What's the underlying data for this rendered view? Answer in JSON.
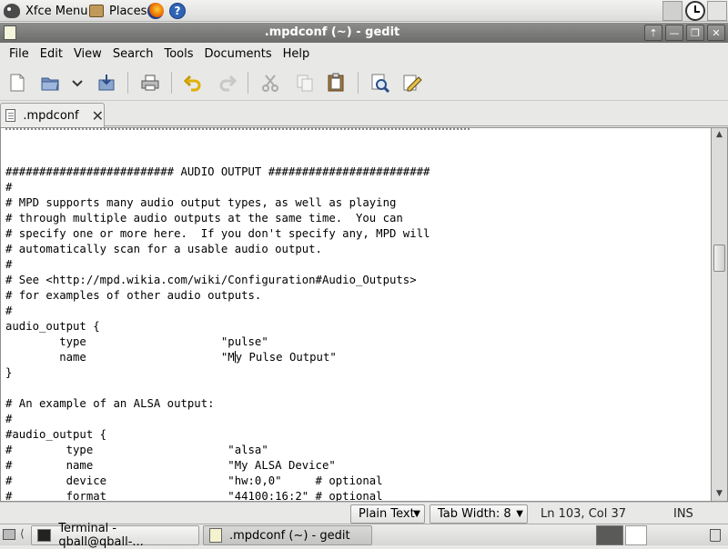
{
  "top_panel": {
    "menu_label": "Xfce Menu",
    "places_label": "Places",
    "help_glyph": "?"
  },
  "window": {
    "title": ".mpdconf (~) - gedit",
    "buttons": [
      "⇡",
      "—",
      "❐",
      "✕"
    ]
  },
  "menubar": {
    "items": [
      {
        "label": "File"
      },
      {
        "label": "Edit"
      },
      {
        "label": "View"
      },
      {
        "label": "Search"
      },
      {
        "label": "Tools"
      },
      {
        "label": "Documents"
      },
      {
        "label": "Help"
      }
    ]
  },
  "toolbar": {
    "icons": [
      "new-document-icon",
      "open-icon",
      "open-dropdown-icon",
      "save-icon",
      "print-icon",
      "undo-icon",
      "redo-icon",
      "cut-icon",
      "copy-icon",
      "paste-icon",
      "find-icon",
      "replace-icon"
    ]
  },
  "tab": {
    "label": ".mpdconf",
    "close_glyph": "✕"
  },
  "editor": {
    "lines": [
      "######################### AUDIO OUTPUT ########################",
      "#",
      "# MPD supports many audio output types, as well as playing",
      "# through multiple audio outputs at the same time.  You can",
      "# specify one or more here.  If you don't specify any, MPD will",
      "# automatically scan for a usable audio output.",
      "#",
      "# See <http://mpd.wikia.com/wiki/Configuration#Audio_Outputs>",
      "# for examples of other audio outputs.",
      "#",
      "audio_output {",
      "        type                    \"pulse\"",
      "        name                    \"My Pulse Output\"",
      "}",
      "",
      "# An example of an ALSA output:",
      "#",
      "#audio_output {",
      "#        type                    \"alsa\"",
      "#        name                    \"My ALSA Device\"",
      "#        device                  \"hw:0,0\"     # optional",
      "#        format                  \"44100:16:2\" # optional"
    ],
    "caret_line": 12,
    "caret_col": 34
  },
  "statusbar": {
    "language": "Plain Text",
    "tab_width": "Tab Width: 8",
    "position": "Ln 103, Col 37",
    "mode": "INS"
  },
  "taskbar": {
    "tasks": [
      {
        "label": "Terminal - qball@qball-..."
      },
      {
        "label": ".mpdconf (~) - gedit"
      }
    ],
    "pager_glyph": "⟨"
  }
}
